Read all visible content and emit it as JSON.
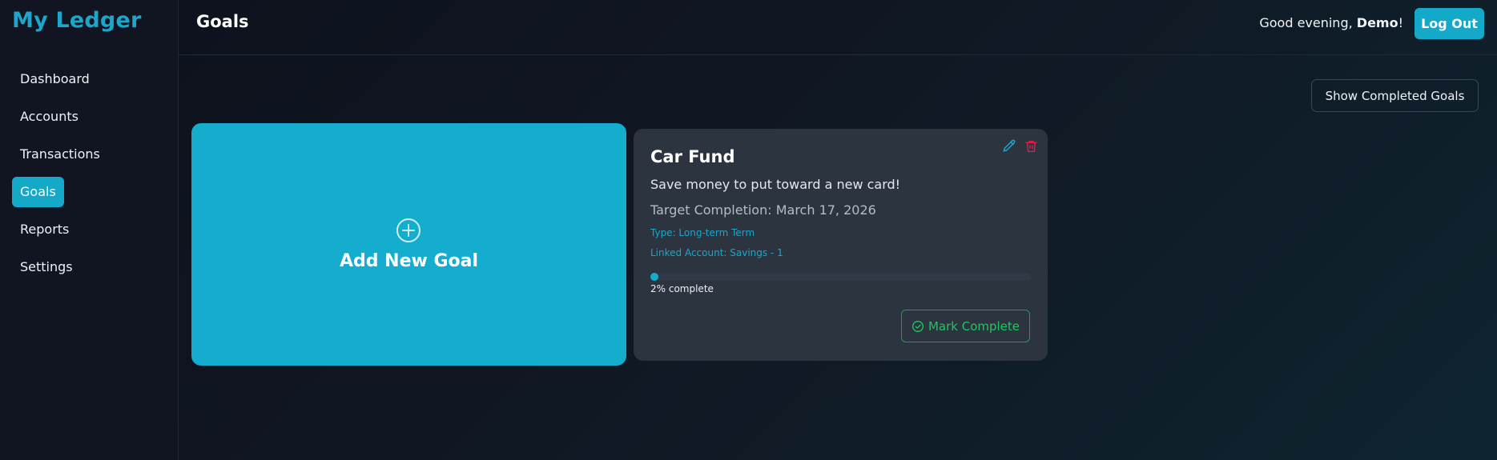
{
  "app": {
    "title": "My Ledger",
    "accent_color": "#14adcd"
  },
  "sidebar": {
    "items": [
      {
        "label": "Dashboard",
        "active": false
      },
      {
        "label": "Accounts",
        "active": false
      },
      {
        "label": "Transactions",
        "active": false
      },
      {
        "label": "Goals",
        "active": true
      },
      {
        "label": "Reports",
        "active": false
      },
      {
        "label": "Settings",
        "active": false
      }
    ]
  },
  "header": {
    "page_title": "Goals",
    "greeting_prefix": "Good evening, ",
    "user_name": "Demo",
    "greeting_suffix": "!",
    "logout_label": "Log Out"
  },
  "main": {
    "show_completed_label": "Show Completed Goals",
    "add_card": {
      "label": "Add New Goal",
      "icon": "plus-circle-icon"
    },
    "goals": [
      {
        "title": "Car Fund",
        "description": "Save money to put toward a new card!",
        "target_completion": "Target Completion: March 17, 2026",
        "type": "Type: Long-term Term",
        "linked_account": "Linked Account: Savings - 1",
        "progress_percent": 2,
        "progress_label": "2% complete",
        "mark_complete_label": "Mark Complete",
        "edit_icon": "pencil-icon",
        "delete_icon": "trash-icon",
        "mark_complete_color": "#22c55e",
        "delete_color": "#e11d48"
      }
    ]
  }
}
